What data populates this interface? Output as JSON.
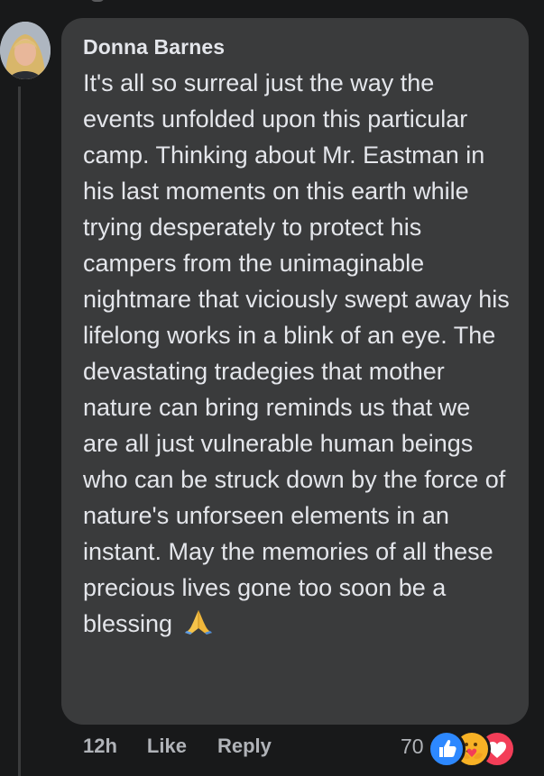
{
  "comment": {
    "author": "Donna Barnes",
    "text": "It's all so surreal just the way the events unfolded upon this particular camp. Thinking about Mr. Eastman in his last moments on this earth while trying desperately to protect his campers from the unimaginable nightmare that viciously swept away his lifelong works in a blink of an eye. The devastating tradegies that mother nature can bring reminds us that we are all just vulnerable human beings who can be struck down by the force of nature's unforseen elements in an instant. May the memories of all these precious lives gone too soon be a blessing",
    "emoji": "folded-hands-icon"
  },
  "actions": {
    "timestamp": "12h",
    "like_label": "Like",
    "reply_label": "Reply"
  },
  "reactions": {
    "count": "70",
    "icons": [
      "like-reaction-icon",
      "care-reaction-icon",
      "love-reaction-icon"
    ]
  },
  "colors": {
    "background": "#18191a",
    "bubble": "#3a3b3c",
    "text_primary": "#e4e6eb",
    "text_secondary": "#b0b3b8",
    "like_blue": "#2d88ff",
    "care_yellow": "#f7b125",
    "love_red": "#f33e58"
  }
}
